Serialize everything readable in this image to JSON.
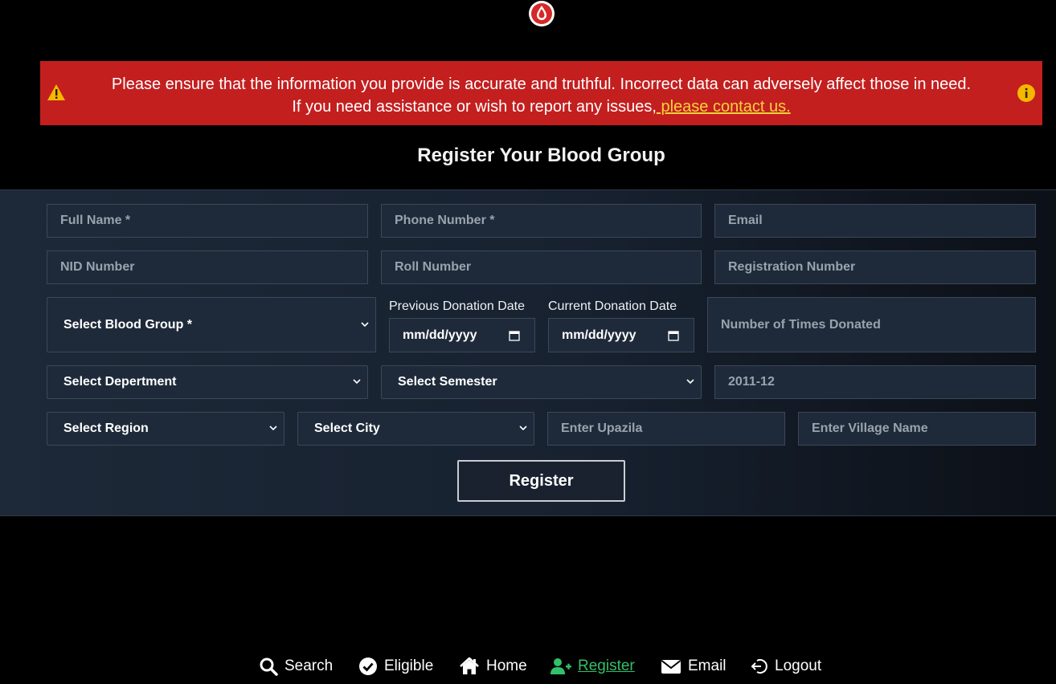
{
  "banner": {
    "line1": "Please ensure that the information you provide is accurate and truthful. Incorrect data can adversely affect those in need.",
    "line2_prefix": "If you need assistance or wish to report any issues,",
    "contact_link": " please contact us."
  },
  "form": {
    "title": "Register Your Blood Group",
    "full_name_placeholder": "Full Name *",
    "phone_placeholder": "Phone Number *",
    "email_placeholder": "Email",
    "nid_placeholder": "NID Number",
    "roll_placeholder": "Roll Number",
    "registration_placeholder": "Registration Number",
    "blood_group_select": "Select Blood Group *",
    "previous_donation_label": "Previous Donation Date",
    "previous_donation_value": "mm/dd/yyyy",
    "current_donation_label": "Current Donation Date",
    "current_donation_value": "mm/dd/yyyy",
    "times_donated_placeholder": "Number of Times Donated",
    "department_select": "Select Depertment",
    "semester_select": "Select Semester",
    "session_placeholder": "2011-12",
    "region_select": "Select Region",
    "city_select": "Select City",
    "upazila_placeholder": "Enter Upazila",
    "village_placeholder": "Enter Village Name",
    "register_button": "Register"
  },
  "nav": {
    "search": "Search",
    "eligible": "Eligible",
    "home": "Home",
    "register": "Register",
    "email": "Email",
    "logout": "Logout"
  },
  "colors": {
    "banner_bg": "#c31f1f",
    "link": "#f7d23b",
    "active_nav": "#32c06a",
    "panel_bg": "#1d2938"
  }
}
